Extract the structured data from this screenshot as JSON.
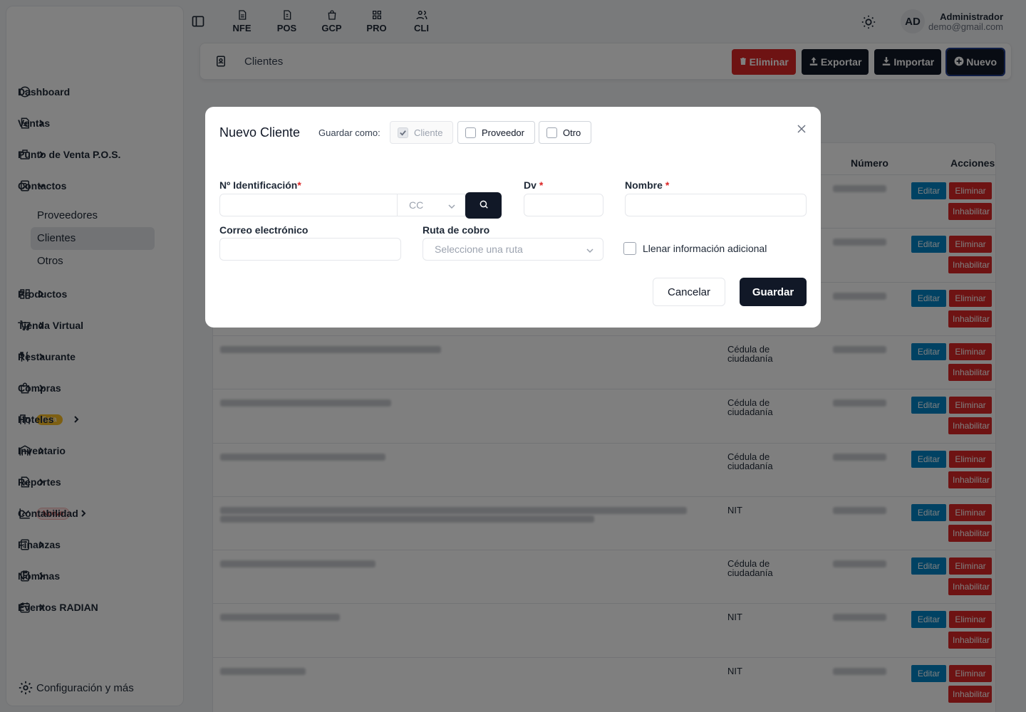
{
  "sidebar": {
    "items": [
      {
        "label": "Dashboard",
        "icon": "dashboard-icon",
        "chevron": false
      },
      {
        "label": "Ventas",
        "icon": "document-icon",
        "chevron": true
      },
      {
        "label": "Punto de Venta P.O.S.",
        "icon": "pos-icon",
        "chevron": true
      },
      {
        "label": "Contactos",
        "icon": "contacts-icon",
        "chevron": true,
        "expanded": true
      }
    ],
    "contactos_sub": [
      "Proveedores",
      "Clientes",
      "Otros"
    ],
    "items2": [
      {
        "label": "Productos",
        "icon": "grid-icon"
      },
      {
        "label": "Tienda Virtual",
        "icon": "cart-icon"
      },
      {
        "label": "Restaurante",
        "icon": "utensils-icon"
      },
      {
        "label": "Compras",
        "icon": "bag-icon"
      },
      {
        "label": "Hoteles",
        "icon": "hotel-icon",
        "badge": "Beta"
      },
      {
        "label": "Inventario",
        "icon": "warehouse-icon"
      },
      {
        "label": "Reportes",
        "icon": "report-icon"
      },
      {
        "label": "Contabilidad",
        "icon": "chart-icon",
        "badge": "Nuevo"
      },
      {
        "label": "Finanzas",
        "icon": "calculator-icon"
      },
      {
        "label": "Nóminas",
        "icon": "payroll-icon"
      },
      {
        "label": "Eventos RADIAN",
        "icon": "calendar-icon"
      }
    ],
    "config_label": "Configuración y más"
  },
  "topbar": {
    "modules": [
      "NFE",
      "POS",
      "GCP",
      "PRO",
      "CLI"
    ],
    "avatar": "AD",
    "user_name": "Administrador",
    "user_email": "demo@gmail.com"
  },
  "header": {
    "breadcrumb": "Clientes",
    "buttons": {
      "eliminar": "Eliminar",
      "exportar": "Exportar",
      "importar": "Importar",
      "nuevo": "Nuevo"
    }
  },
  "table": {
    "columns": {
      "numero": "Número",
      "acciones": "Acciones"
    },
    "actions": {
      "edit": "Editar",
      "delete": "Eliminar",
      "disable": "Inhabilitar"
    },
    "rows": [
      {
        "tipo": ""
      },
      {
        "tipo": ""
      },
      {
        "tipo": ""
      },
      {
        "tipo": "Cédula de ciudadanía"
      },
      {
        "tipo": "Cédula de ciudadanía"
      },
      {
        "tipo": "Cédula de ciudadanía"
      },
      {
        "tipo": "NIT"
      },
      {
        "tipo": "Cédula de ciudadanía"
      },
      {
        "tipo": "NIT"
      },
      {
        "tipo": "NIT"
      }
    ]
  },
  "modal": {
    "title": "Nuevo Cliente",
    "guardar_como": "Guardar como:",
    "options": {
      "cliente": "Cliente",
      "proveedor": "Proveedor",
      "otro": "Otro"
    },
    "fields": {
      "identificacion_label": "Nº Identificación",
      "doc_type": "CC",
      "dv_label": "Dv",
      "nombre_label": "Nombre",
      "correo_label": "Correo electrónico",
      "ruta_label": "Ruta de cobro",
      "ruta_placeholder": "Seleccione una ruta",
      "llenar_label": "Llenar información adicional"
    },
    "required_mark": "*",
    "cancel": "Cancelar",
    "save": "Guardar"
  }
}
